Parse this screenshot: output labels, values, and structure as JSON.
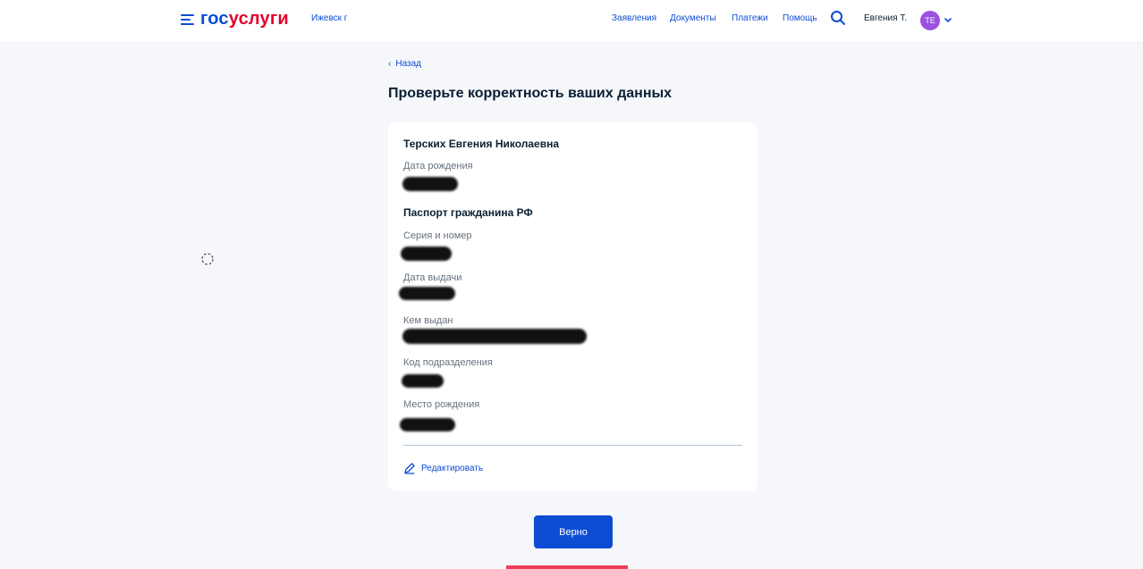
{
  "header": {
    "logo_gos": "гос",
    "logo_uslugi": "услуги",
    "city": "Ижевск г",
    "nav": [
      "Заявления",
      "Документы",
      "Платежи",
      "Помощь"
    ],
    "user_name": "Евгения Т.",
    "avatar_initials": "ТЕ",
    "icons": [
      "menu-icon",
      "search-icon",
      "chevron-down-icon"
    ]
  },
  "back_label": "Назад",
  "page_title": "Проверьте корректность ваших данных",
  "card": {
    "full_name": "Терских Евгения Николаевна",
    "birth_date_label": "Дата рождения",
    "passport_title": "Паспорт гражданина РФ",
    "series_label": "Серия и номер",
    "issue_date_label": "Дата выдачи",
    "issued_by_label": "Кем выдан",
    "department_code_label": "Код подразделения",
    "birth_place_label": "Место рождения",
    "edit_label": "Редактировать"
  },
  "confirm_label": "Верно",
  "colors": {
    "brand_blue": "#0d4cd3",
    "brand_red": "#e3002b",
    "avatar": "#9b51e0",
    "background": "#f5f7fb"
  }
}
